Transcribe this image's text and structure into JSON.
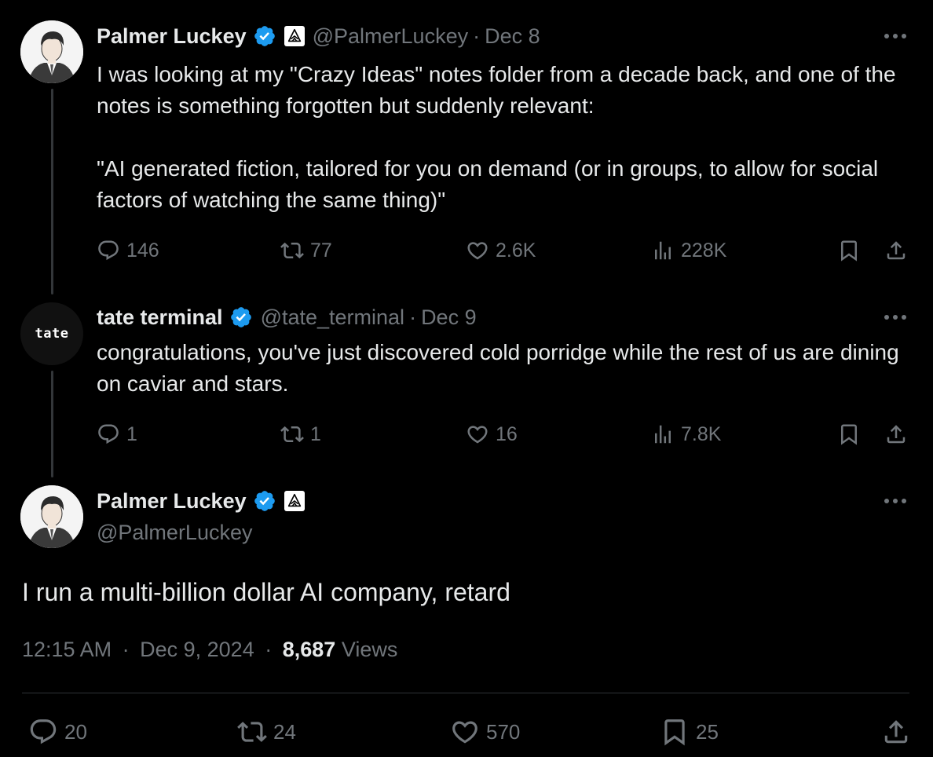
{
  "tweets": [
    {
      "name": "Palmer Luckey",
      "handle": "@PalmerLuckey",
      "separator": "·",
      "date": "Dec 8",
      "text": "I was looking at my \"Crazy Ideas\" notes folder from a decade back, and one of the notes is something forgotten but suddenly relevant:\n\n\"AI generated fiction, tailored for you on demand (or in groups, to allow for social factors of watching the same thing)\"",
      "replies": "146",
      "reposts": "77",
      "likes": "2.6K",
      "views": "228K"
    },
    {
      "name": "tate terminal",
      "handle": "@tate_terminal",
      "separator": "·",
      "date": "Dec 9",
      "avatar_text": "tate",
      "text": "congratulations, you've just discovered cold porridge while the rest of us are dining on caviar and stars.",
      "replies": "1",
      "reposts": "1",
      "likes": "16",
      "views": "7.8K"
    }
  ],
  "main_tweet": {
    "name": "Palmer Luckey",
    "handle": "@PalmerLuckey",
    "text": "I run a multi-billion dollar AI company, retard",
    "time": "12:15 AM",
    "separator": "·",
    "date": "Dec 9, 2024",
    "views_count": "8,687",
    "views_label": "Views",
    "replies": "20",
    "reposts": "24",
    "likes": "570",
    "bookmarks": "25"
  },
  "colors": {
    "background": "#000000",
    "text": "#e7e9ea",
    "muted": "#71767b",
    "verified": "#1d9bf0",
    "divider": "#2f3336"
  },
  "icons": [
    "reply-icon",
    "repost-icon",
    "like-icon",
    "views-icon",
    "bookmark-icon",
    "share-icon",
    "more-icon",
    "verified-badge-icon",
    "affiliate-badge-icon"
  ]
}
